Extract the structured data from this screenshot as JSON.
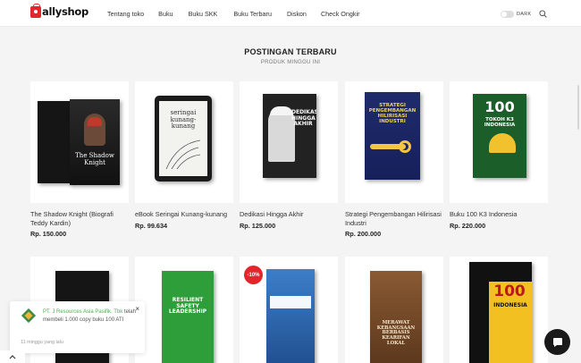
{
  "header": {
    "logo_text": "allyshop",
    "nav": [
      "Tentang toko",
      "Buku",
      "Buku SKK",
      "Buku Terbaru",
      "Diskon",
      "Check Ongkir"
    ],
    "dark_label": "DARK"
  },
  "section": {
    "title": "POSTINGAN TERBARU",
    "subtitle": "PRODUK MINGGU INI"
  },
  "products": [
    {
      "title": "The Shadow Knight (Biografi Teddy Kardin)",
      "price": "Rp. 150.000"
    },
    {
      "title": "eBook Seringai Kunang-kunang",
      "price": "Rp. 99.634"
    },
    {
      "title": "Dedikasi Hingga Akhir",
      "price": "Rp. 125.000"
    },
    {
      "title": "Strategi Pengembangan Hilirisasi Industri",
      "price": "Rp. 200.000"
    },
    {
      "title": "Buku 100 K3 Indonesia",
      "price": "Rp. 220.000"
    }
  ],
  "covers": {
    "c1_title": "The Shadow Knight",
    "c2_title": "seringai kunang-kunang",
    "c3_title": "DEDIKASI HINGGA AKHIR",
    "c4_title": "STRATEGI PENGEMBANGAN HILIRISASI INDUSTRI",
    "c5_num": "100",
    "c5_title": "TOKOH K3 INDONESIA",
    "r2_2_title": "RESILIENT SAFETY LEADERSHIP",
    "r2_4_title": "MERAWAT KEBANGSAAN BERBASIS KEARIFAN LOKAL",
    "r2_5_num": "100",
    "r2_5_title": "INDONESIA"
  },
  "discount_badge": "-10%",
  "popup": {
    "company": "PT. J Resources Asia Pasifik. Tbk",
    "message": " telah membeli 1.000 copy buku 100 ATI",
    "time": "11 minggu yang lalu",
    "close": "×"
  },
  "colors": {
    "brand": "#e4252b",
    "accent_green": "#4caf50"
  },
  "icons": [
    "shopping-bag-icon",
    "search-icon",
    "close-icon",
    "chevron-up-icon",
    "chat-icon"
  ]
}
